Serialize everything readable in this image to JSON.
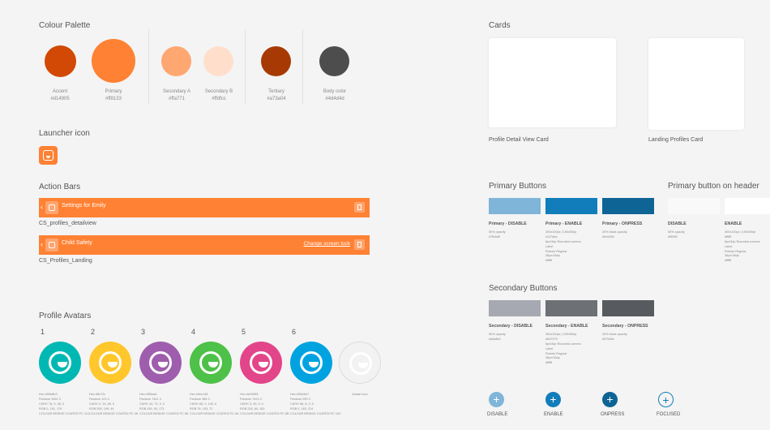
{
  "palette": {
    "heading": "Colour Palette",
    "swatches": [
      {
        "name": "Accent",
        "hex": "#d14905",
        "color": "#d14905"
      },
      {
        "name": "Primary",
        "hex": "#ff8133",
        "color": "#ff8133"
      },
      {
        "name": "Secondary A",
        "hex": "#ffa771",
        "color": "#ffa771"
      },
      {
        "name": "Secondary B",
        "hex": "#ffdfcc",
        "color": "#ffdfcc"
      },
      {
        "name": "Tertiary",
        "hex": "#a73a04",
        "color": "#a73a04"
      },
      {
        "name": "Body color",
        "hex": "#4d4d4d",
        "color": "#4d4d4d"
      }
    ]
  },
  "launcher": {
    "heading": "Launcher icon"
  },
  "action_bars": {
    "heading": "Action Bars",
    "bars": [
      {
        "title": "Settings for Emily",
        "link": "",
        "caption": "CS_profiles_detailview"
      },
      {
        "title": "Child Safety",
        "link": "Change screen lock",
        "caption": "CS_Profiles_Landing"
      }
    ]
  },
  "avatars": {
    "heading": "Profile Avatars",
    "items": [
      {
        "num": "1",
        "color": "#00b8b3",
        "lines": [
          "Hex #00b8b3",
          "Pantone 3262 C",
          "CMYK 76, 0, 38, 0",
          "RGB 0, 191, 179",
          "COLOUR BRIDGE COATED PC 12J"
        ]
      },
      {
        "num": "2",
        "color": "#ffc72c",
        "lines": [
          "Hex #ffc72c",
          "Pantone 123 C",
          "CMYK 0, 19, 89, 0",
          "RGB 255, 199, 44",
          "COLOUR BRIDGE COATED PC 46"
        ]
      },
      {
        "num": "3",
        "color": "#9f5dad",
        "lines": [
          "Hex #9f5dad",
          "Pantone 7441 C",
          "CMYK 44, 70, 0, 0",
          "RGB 159, 93, 173",
          "COLOUR BRIDGE COATED PC 86"
        ]
      },
      {
        "num": "4",
        "color": "#4ec148",
        "lines": [
          "Hex #4ec148",
          "Pantone 368 C",
          "CMYK 65, 0, 100, 0",
          "RGB 78, 193, 72",
          "COLOUR BRIDGE COATED PC 6A"
        ]
      },
      {
        "num": "5",
        "color": "#e24589",
        "lines": [
          "Hex #e24589",
          "Pantone 7424 C",
          "CMYK 0, 90, 9, 0",
          "RGB 226, 69, 153",
          "COLOUR BRIDGE COATED PC 6B"
        ]
      },
      {
        "num": "6",
        "color": "#00a3e0",
        "lines": [
          "Hex #00a3e0",
          "Pantone 299 C",
          "CMYK 86, 8, 0, 0",
          "RGB 0, 163, 224",
          "COLOUR BRIDGE COATED PC 10C"
        ]
      },
      {
        "num": "",
        "color": "#f2f2f2",
        "lines": [
          "Avatar Icon"
        ]
      }
    ]
  },
  "cards": {
    "heading": "Cards",
    "items": [
      {
        "caption": "Profile Detail View Card"
      },
      {
        "caption": "Landing Profiles Card"
      }
    ]
  },
  "primary_buttons": {
    "heading": "Primary Buttons",
    "items": [
      {
        "label": "Primary - DISABLE",
        "color": "#7fb5d8",
        "lines": [
          "50% opacity",
          "#7fb5d8"
        ]
      },
      {
        "label": "Primary - ENABLE",
        "color": "#117dba",
        "lines": [
          "300x100px | 150x50dp",
          "#117dba",
          "6px/3dp Rounded corners",
          "Label",
          "Roboto Regular",
          "36px/18dp",
          "#ffffff"
        ]
      },
      {
        "label": "Primary - ONPRESS",
        "color": "#0e6495",
        "lines": [
          "20% black opacity",
          "#0e6495"
        ]
      }
    ]
  },
  "header_buttons": {
    "heading": "Primary button on header",
    "items": [
      {
        "label": "DISABLE",
        "color": "#f9f9f9",
        "lines": [
          "50% opacity",
          "#f9f9f9"
        ]
      },
      {
        "label": "ENABLE",
        "color": "#ffffff",
        "lines": [
          "300x100px | 150x50dp",
          "#ffffff",
          "6px/3dp Rounded corners",
          "Label",
          "Roboto Regular",
          "36px/18dp",
          "#ffffff"
        ]
      }
    ]
  },
  "secondary_buttons": {
    "heading": "Secondary Buttons",
    "items": [
      {
        "label": "Secondary - DISABLE",
        "color": "#a6a8b2",
        "lines": [
          "50% opacity",
          "#a6a8b2"
        ]
      },
      {
        "label": "Secondary - ENABLE",
        "color": "#6d7075",
        "lines": [
          "300x100px | 150x50dp",
          "#6d7075",
          "6px/3dp Rounded corners",
          "Label",
          "Roboto Regular",
          "36px/18dp",
          "#ffffff"
        ]
      },
      {
        "label": "Secondary - ONPRESS",
        "color": "#575a5e",
        "lines": [
          "20% black opacity",
          "#575a5e"
        ]
      }
    ]
  },
  "fab": {
    "items": [
      {
        "label": "DISABLE",
        "color": "#7fb5d8",
        "filled": true
      },
      {
        "label": "ENABLE",
        "color": "#117dba",
        "filled": true
      },
      {
        "label": "ONPRESS",
        "color": "#0e6495",
        "filled": true
      },
      {
        "label": "FOCUSED",
        "color": "#117dba",
        "filled": false
      }
    ]
  }
}
